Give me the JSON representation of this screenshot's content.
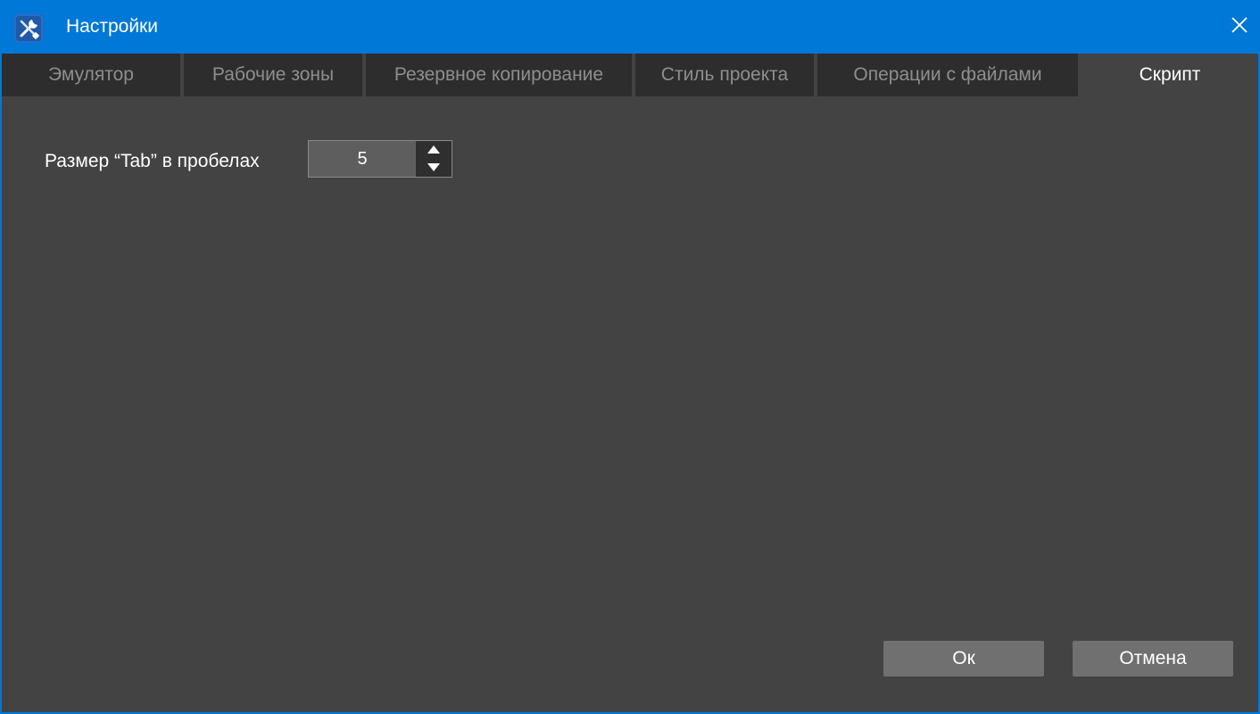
{
  "window": {
    "title": "Настройки"
  },
  "tabs": [
    {
      "label": "Эмулятор",
      "active": false
    },
    {
      "label": "Рабочие зоны",
      "active": false
    },
    {
      "label": "Резервное копирование",
      "active": false
    },
    {
      "label": "Стиль проекта",
      "active": false
    },
    {
      "label": "Операции с файлами",
      "active": false
    },
    {
      "label": "Скрипт",
      "active": true
    }
  ],
  "script_settings": {
    "tab_size_label": "Размер “Tab” в пробелах",
    "tab_size_value": "5"
  },
  "footer": {
    "ok_label": "Ок",
    "cancel_label": "Отмена"
  },
  "colors": {
    "titlebar": "#0078d7",
    "panel": "#434343",
    "tab_inactive": "#2d2d2d",
    "button": "#707070"
  },
  "icons": {
    "app": "tools-icon",
    "close": "close-icon",
    "spinner_up": "arrow-up-icon",
    "spinner_down": "arrow-down-icon"
  }
}
